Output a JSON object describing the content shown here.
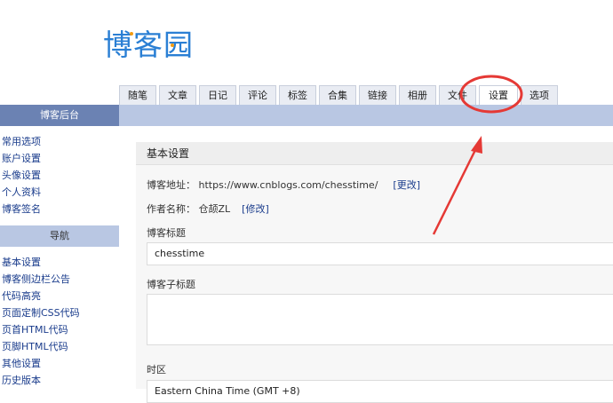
{
  "logo": {
    "text": "博客园"
  },
  "tabs": [
    {
      "label": "随笔"
    },
    {
      "label": "文章"
    },
    {
      "label": "日记"
    },
    {
      "label": "评论"
    },
    {
      "label": "标签"
    },
    {
      "label": "合集"
    },
    {
      "label": "链接"
    },
    {
      "label": "相册"
    },
    {
      "label": "文件"
    },
    {
      "label": "设置"
    },
    {
      "label": "选项"
    }
  ],
  "sidebar": {
    "title": "博客后台",
    "links": [
      "常用选项",
      "账户设置",
      "头像设置",
      "个人资料",
      "博客签名"
    ],
    "nav_title": "导航",
    "nav_links": [
      "基本设置",
      "博客侧边栏公告",
      "代码高亮",
      "页面定制CSS代码",
      "页首HTML代码",
      "页脚HTML代码",
      "其他设置",
      "历史版本"
    ]
  },
  "main": {
    "section_title": "基本设置",
    "blog_url_label": "博客地址：",
    "blog_url": "https://www.cnblogs.com/chesstime/",
    "blog_url_change": "[更改]",
    "author_label": "作者名称：",
    "author_name": "仓颉ZL",
    "author_change": "[修改]",
    "blog_title_label": "博客标题",
    "blog_title_value": "chesstime",
    "subtitle_label": "博客子标题",
    "timezone_label": "时区",
    "timezone_value": "Eastern China Time (GMT +8)"
  },
  "colors": {
    "accent": "#e53935",
    "logo": "#2a7fd4",
    "link": "#1a3c8c",
    "header": "#b9c7e3"
  }
}
